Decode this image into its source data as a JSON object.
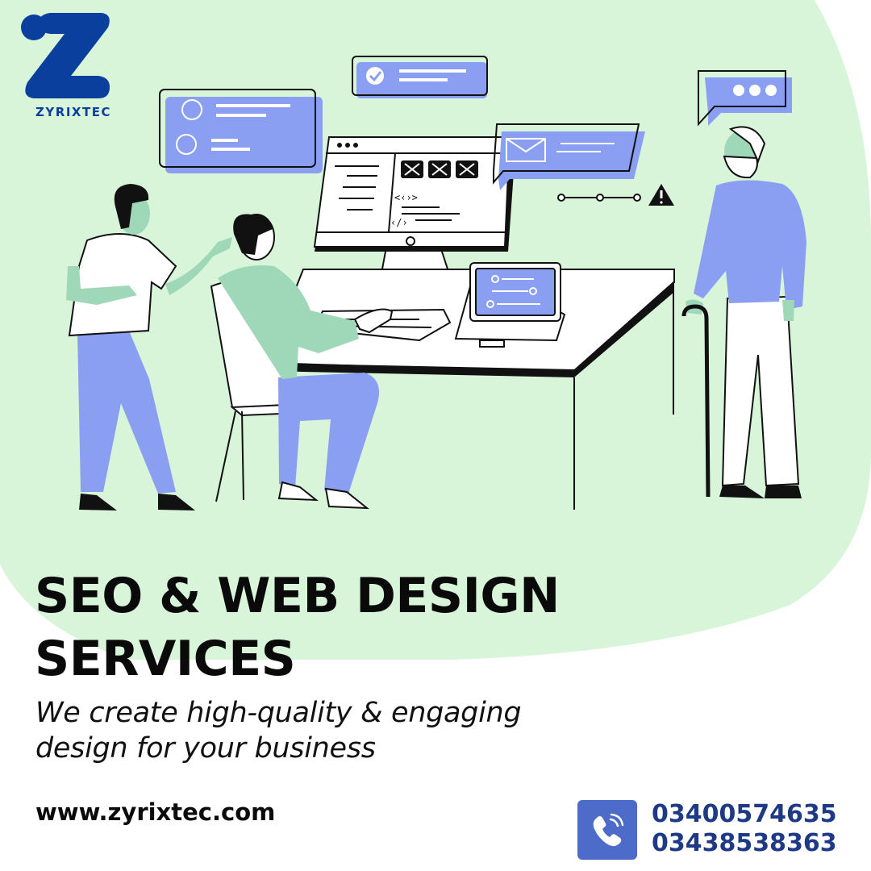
{
  "brand": {
    "name": "ZYRIXTEC",
    "logo_icon": "z-logo-icon",
    "color": "#0b3f9e"
  },
  "headline": {
    "line1": "SEO & WEB DESIGN",
    "line2": "SERVICES"
  },
  "tagline": {
    "line1": "We create high-quality & engaging",
    "line2": "design for your business"
  },
  "contact": {
    "website": "www.zyrixtec.com",
    "phone_icon": "phone-icon",
    "phones": [
      "03400574635",
      "03438538363"
    ]
  },
  "illustration": {
    "name": "team-web-design-illustration",
    "code_tag_1": "<‹›>",
    "code_tag_2": "‹/›"
  },
  "colors": {
    "blob": "#d9f5d9",
    "accent_blue": "#8b9ff2",
    "skin_green": "#9fd8b8",
    "phone_box": "#4d6cc9",
    "phone_text": "#1e3a86"
  }
}
